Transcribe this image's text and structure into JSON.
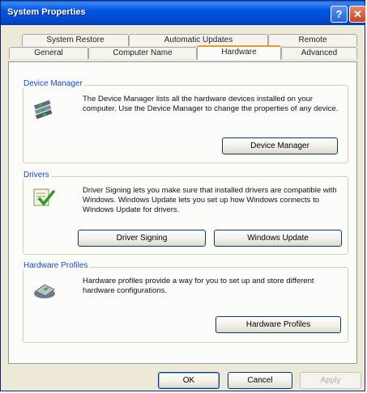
{
  "window": {
    "title": "System Properties",
    "help_glyph": "?",
    "close_glyph": "✕"
  },
  "tabs": {
    "row1": [
      "System Restore",
      "Automatic Updates",
      "Remote"
    ],
    "row2": [
      "General",
      "Computer Name",
      "Hardware",
      "Advanced"
    ],
    "active": "Hardware"
  },
  "device_manager": {
    "title": "Device Manager",
    "description": "The Device Manager lists all the hardware devices installed on your computer. Use the Device Manager to change the properties of any device.",
    "button": "Device Manager",
    "icon": "device-manager-icon"
  },
  "drivers": {
    "title": "Drivers",
    "description": "Driver Signing lets you make sure that installed drivers are compatible with Windows. Windows Update lets you set up how Windows connects to Windows Update for drivers.",
    "signing_button": "Driver Signing",
    "update_button": "Windows Update",
    "icon": "driver-signing-icon"
  },
  "hardware_profiles": {
    "title": "Hardware Profiles",
    "description": "Hardware profiles provide a way for you to set up and store different hardware configurations.",
    "button": "Hardware Profiles",
    "icon": "hardware-profiles-icon"
  },
  "footer": {
    "ok": "OK",
    "cancel": "Cancel",
    "apply": "Apply"
  }
}
